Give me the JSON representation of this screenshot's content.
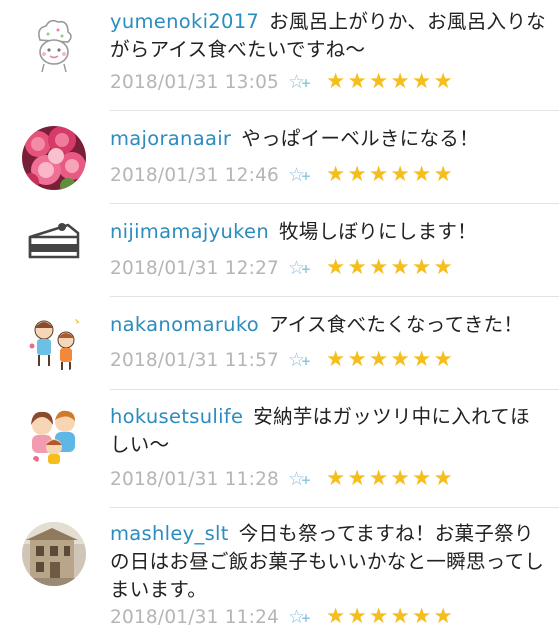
{
  "comments": [
    {
      "username": "yumenoki2017",
      "message": "お風呂上がりか、お風呂入りながらアイス食べたいですね〜",
      "timestamp": "2018/01/31 13:05",
      "fav_icon": "star-outline-plus-icon",
      "stars": 6,
      "avatar": "chef-character-avatar"
    },
    {
      "username": "majoranaair",
      "message": "やっぱイーベルきになる！",
      "timestamp": "2018/01/31 12:46",
      "fav_icon": "star-outline-plus-icon",
      "stars": 6,
      "avatar": "pink-roses-avatar"
    },
    {
      "username": "nijimamajyuken",
      "message": "牧場しぼりにします！",
      "timestamp": "2018/01/31 12:27",
      "fav_icon": "star-outline-plus-icon",
      "stars": 6,
      "avatar": "cake-slice-avatar"
    },
    {
      "username": "nakanomaruko",
      "message": "アイス食べたくなってきた！",
      "timestamp": "2018/01/31 11:57",
      "fav_icon": "star-outline-plus-icon",
      "stars": 6,
      "avatar": "children-illustration-avatar"
    },
    {
      "username": "hokusetsulife",
      "message": "安納芋はガッツリ中に入れてほしい〜",
      "timestamp": "2018/01/31 11:28",
      "fav_icon": "star-outline-plus-icon",
      "stars": 6,
      "avatar": "family-illustration-avatar"
    },
    {
      "username": "mashley_slt",
      "message": "今日も祭ってますね！お菓子祭りの日はお昼ご飯お菓子もいいかなと一瞬思ってしまいます。",
      "timestamp": "2018/01/31 11:24",
      "fav_icon": "star-outline-plus-icon",
      "stars": 6,
      "avatar": "miniature-house-avatar"
    }
  ],
  "colors": {
    "username": "#2b8cbf",
    "timestamp": "#b5b5b5",
    "star": "#f5be1d",
    "fav_icon": "#8ec4de",
    "divider": "#e3e3e3"
  },
  "glyphs": {
    "star": "★",
    "star_outline": "☆",
    "plus": "+"
  }
}
